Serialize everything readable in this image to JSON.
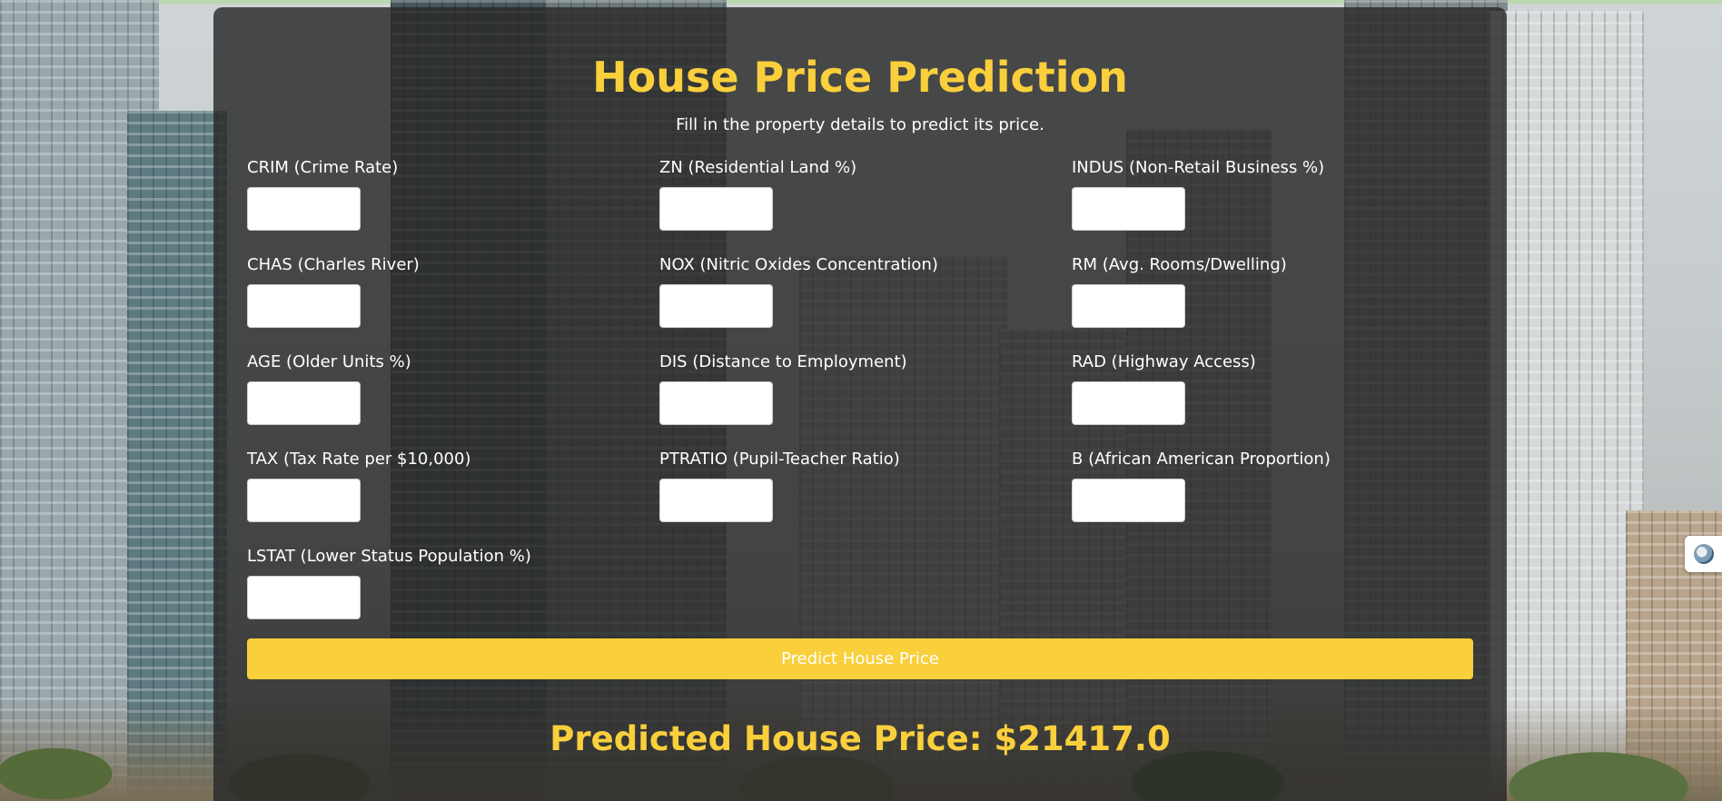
{
  "page": {
    "title": "House Price Prediction",
    "subtitle": "Fill in the property details to predict its price."
  },
  "form": {
    "fields": [
      {
        "label": "CRIM (Crime Rate)",
        "value": ""
      },
      {
        "label": "ZN (Residential Land %)",
        "value": ""
      },
      {
        "label": "INDUS (Non-Retail Business %)",
        "value": ""
      },
      {
        "label": "CHAS (Charles River)",
        "value": ""
      },
      {
        "label": "NOX (Nitric Oxides Concentration)",
        "value": ""
      },
      {
        "label": "RM (Avg. Rooms/Dwelling)",
        "value": ""
      },
      {
        "label": "AGE (Older Units %)",
        "value": ""
      },
      {
        "label": "DIS (Distance to Employment)",
        "value": ""
      },
      {
        "label": "RAD (Highway Access)",
        "value": ""
      },
      {
        "label": "TAX (Tax Rate per $10,000)",
        "value": ""
      },
      {
        "label": "PTRATIO (Pupil-Teacher Ratio)",
        "value": ""
      },
      {
        "label": "B (African American Proportion)",
        "value": ""
      },
      {
        "label": "LSTAT (Lower Status Population %)",
        "value": ""
      }
    ],
    "submit_label": "Predict House Price"
  },
  "result": {
    "text": "Predicted House Price: $21417.0"
  },
  "colors": {
    "accent": "#f9cf3c",
    "panel": "#282828"
  },
  "icons": {
    "side_badge": "extension-icon"
  }
}
